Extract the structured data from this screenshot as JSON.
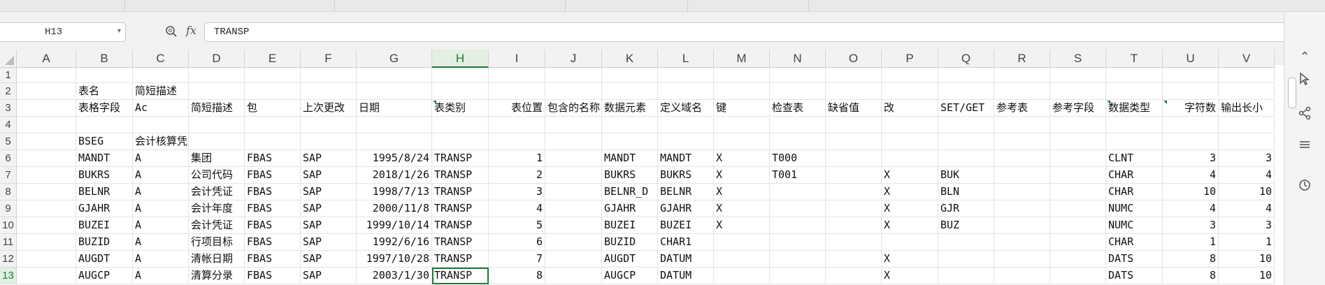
{
  "name_box": "H13",
  "formula_icons": {
    "zoom": "zoom-icon",
    "fx": "fx"
  },
  "formula_value": "TRANSP",
  "columns": [
    "A",
    "B",
    "C",
    "D",
    "E",
    "F",
    "G",
    "H",
    "I",
    "J",
    "K",
    "L",
    "M",
    "N",
    "O",
    "P",
    "Q",
    "R",
    "S",
    "T",
    "U",
    "V"
  ],
  "rows": [
    "1",
    "2",
    "3",
    "4",
    "5",
    "6",
    "7",
    "8",
    "9",
    "10",
    "11",
    "12",
    "13"
  ],
  "selected_column": "H",
  "selected_row": "13",
  "cells": {
    "2": {
      "B": "表名",
      "C": "简短描述"
    },
    "3": {
      "B": "表格字段",
      "C": "Ac",
      "D": "简短描述",
      "E": "包",
      "F": "上次更改",
      "G": "日期",
      "H": "表类别",
      "I": "表位置",
      "J": "包含的名称",
      "K": "数据元素",
      "L": "定义域名",
      "M": "键",
      "N": "检查表",
      "O": "缺省值",
      "P": "改",
      "Q": "SET/GET",
      "R": "参考表",
      "S": "参考字段",
      "T": "数据类型",
      "U": "字符数",
      "V": "输出长小"
    },
    "5": {
      "B": "BSEG",
      "C": "会计核算凭证段"
    },
    "6": {
      "B": "MANDT",
      "C": "A",
      "D": "集团",
      "E": "FBAS",
      "F": "SAP",
      "G": "1995/8/24",
      "H": "TRANSP",
      "I": "1",
      "K": "MANDT",
      "L": "MANDT",
      "M": "X",
      "N": "T000",
      "T": "CLNT",
      "U": "3",
      "V": "3"
    },
    "7": {
      "B": "BUKRS",
      "C": "A",
      "D": "公司代码",
      "E": "FBAS",
      "F": "SAP",
      "G": "2018/1/26",
      "H": "TRANSP",
      "I": "2",
      "K": "BUKRS",
      "L": "BUKRS",
      "M": "X",
      "N": "T001",
      "P": "X",
      "Q": "BUK",
      "T": "CHAR",
      "U": "4",
      "V": "4"
    },
    "8": {
      "B": "BELNR",
      "C": "A",
      "D": "会计凭证",
      "E": "FBAS",
      "F": "SAP",
      "G": "1998/7/13",
      "H": "TRANSP",
      "I": "3",
      "K": "BELNR_D",
      "L": "BELNR",
      "M": "X",
      "P": "X",
      "Q": "BLN",
      "T": "CHAR",
      "U": "10",
      "V": "10"
    },
    "9": {
      "B": "GJAHR",
      "C": "A",
      "D": "会计年度",
      "E": "FBAS",
      "F": "SAP",
      "G": "2000/11/8",
      "H": "TRANSP",
      "I": "4",
      "K": "GJAHR",
      "L": "GJAHR",
      "M": "X",
      "P": "X",
      "Q": "GJR",
      "T": "NUMC",
      "U": "4",
      "V": "4"
    },
    "10": {
      "B": "BUZEI",
      "C": "A",
      "D": "会计凭证",
      "E": "FBAS",
      "F": "SAP",
      "G": "1999/10/14",
      "H": "TRANSP",
      "I": "5",
      "K": "BUZEI",
      "L": "BUZEI",
      "M": "X",
      "P": "X",
      "Q": "BUZ",
      "T": "NUMC",
      "U": "3",
      "V": "3"
    },
    "11": {
      "B": "BUZID",
      "C": "A",
      "D": "行项目标",
      "E": "FBAS",
      "F": "SAP",
      "G": "1992/6/16",
      "H": "TRANSP",
      "I": "6",
      "K": "BUZID",
      "L": "CHAR1",
      "T": "CHAR",
      "U": "1",
      "V": "1"
    },
    "12": {
      "B": "AUGDT",
      "C": "A",
      "D": "清帐日期",
      "E": "FBAS",
      "F": "SAP",
      "G": "1997/10/28",
      "H": "TRANSP",
      "I": "7",
      "K": "AUGDT",
      "L": "DATUM",
      "P": "X",
      "T": "DATS",
      "U": "8",
      "V": "10"
    },
    "13": {
      "B": "AUGCP",
      "C": "A",
      "D": "清算分录",
      "E": "FBAS",
      "F": "SAP",
      "G": "2003/1/30",
      "H": "TRANSP",
      "I": "8",
      "K": "AUGCP",
      "L": "DATUM",
      "P": "X",
      "T": "DATS",
      "U": "8",
      "V": "10"
    }
  },
  "sidebar_icons": [
    "scroll-up-icon",
    "cursor-icon",
    "share-icon",
    "settings-icon",
    "history-icon"
  ]
}
